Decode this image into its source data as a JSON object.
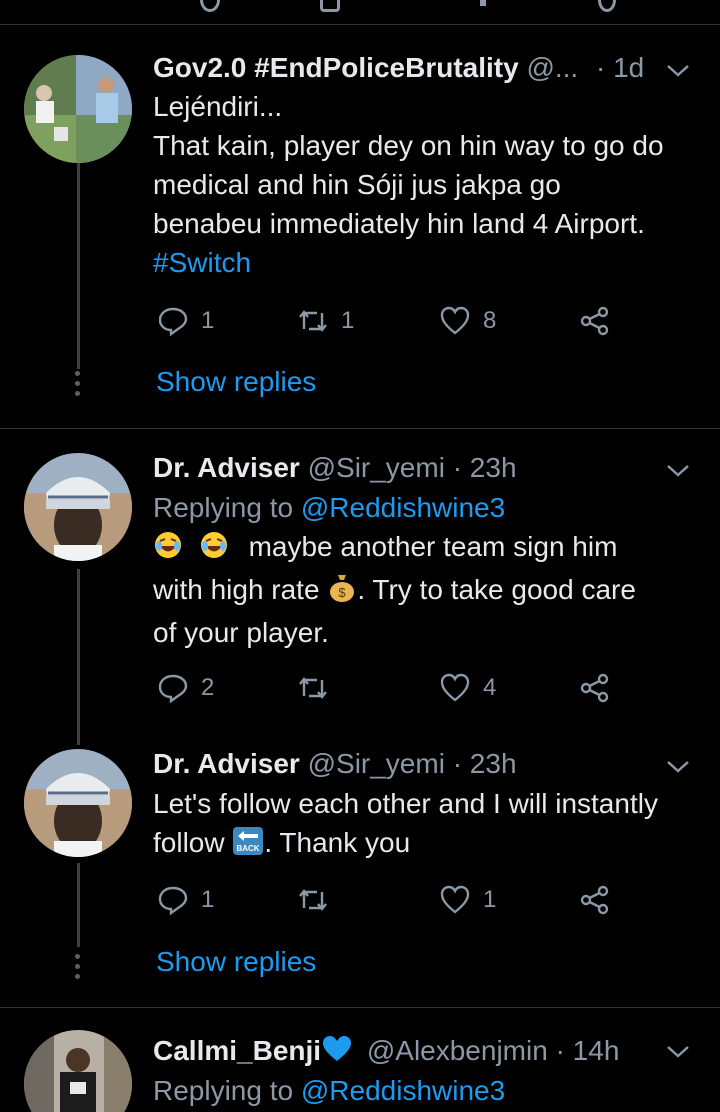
{
  "tweets": [
    {
      "name": "Gov2.0 #EndPoliceBrutality",
      "handle": "@...",
      "time": "· 1d",
      "lines": [
        "Lejéndiri...",
        "That kain, player dey on hin way to go do",
        "medical and hin Sóji jus jakpa go",
        "benabeu immediately hin land 4 Airport."
      ],
      "hashtag": "#Switch",
      "replies": "1",
      "retweets": "1",
      "likes": "8",
      "show_replies": "Show replies"
    },
    {
      "name": "Dr. Adviser",
      "handle": "@Sir_yemi · 23h",
      "replying_prefix": "Replying to",
      "replying_to": "@Reddishwine3",
      "line1": "maybe another team sign him",
      "line2a": "with high rate",
      "line2b": ". Try to take good care",
      "line3": "of your player.",
      "replies": "2",
      "retweets": "",
      "likes": "4"
    },
    {
      "name": "Dr. Adviser",
      "handle": "@Sir_yemi · 23h",
      "line1": "Let's follow each other and I will instantly",
      "line2a": "follow",
      "line2b": ".  Thank you",
      "back_label": "BACK",
      "replies": "1",
      "retweets": "",
      "likes": "1",
      "show_replies": "Show replies"
    },
    {
      "name": "Callmi_Benji",
      "handle": "@Alexbenjmin · 14h",
      "replying_prefix": "Replying to",
      "replying_to": "@Reddishwine3"
    }
  ],
  "colors": {
    "link": "#1d9bf0",
    "muted": "#8b98a5",
    "divider": "#2f3336",
    "heart": "#1d9bf0"
  }
}
